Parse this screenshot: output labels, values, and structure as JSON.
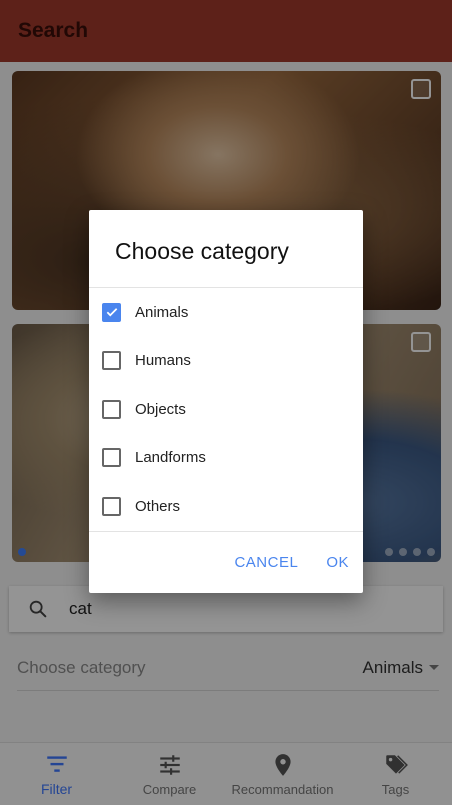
{
  "appbar": {
    "title": "Search"
  },
  "cards": [
    {
      "name": "card-image-1"
    },
    {
      "name": "card-image-2"
    }
  ],
  "search": {
    "value": "cat"
  },
  "category_row": {
    "label": "Choose category",
    "selected": "Animals"
  },
  "bottom_nav": {
    "items": [
      {
        "label": "Filter",
        "icon": "filter-icon",
        "active": true
      },
      {
        "label": "Compare",
        "icon": "sliders-icon",
        "active": false
      },
      {
        "label": "Recommandation",
        "icon": "location-pin-icon",
        "active": false
      },
      {
        "label": "Tags",
        "icon": "tags-icon",
        "active": false
      }
    ]
  },
  "dialog": {
    "title": "Choose category",
    "options": [
      {
        "label": "Animals",
        "checked": true
      },
      {
        "label": "Humans",
        "checked": false
      },
      {
        "label": "Objects",
        "checked": false
      },
      {
        "label": "Landforms",
        "checked": false
      },
      {
        "label": "Others",
        "checked": false
      }
    ],
    "cancel_label": "CANCEL",
    "ok_label": "OK"
  },
  "colors": {
    "appbar": "#a0392c",
    "accent": "#4a85ee",
    "nav_active": "#3f78ff"
  }
}
